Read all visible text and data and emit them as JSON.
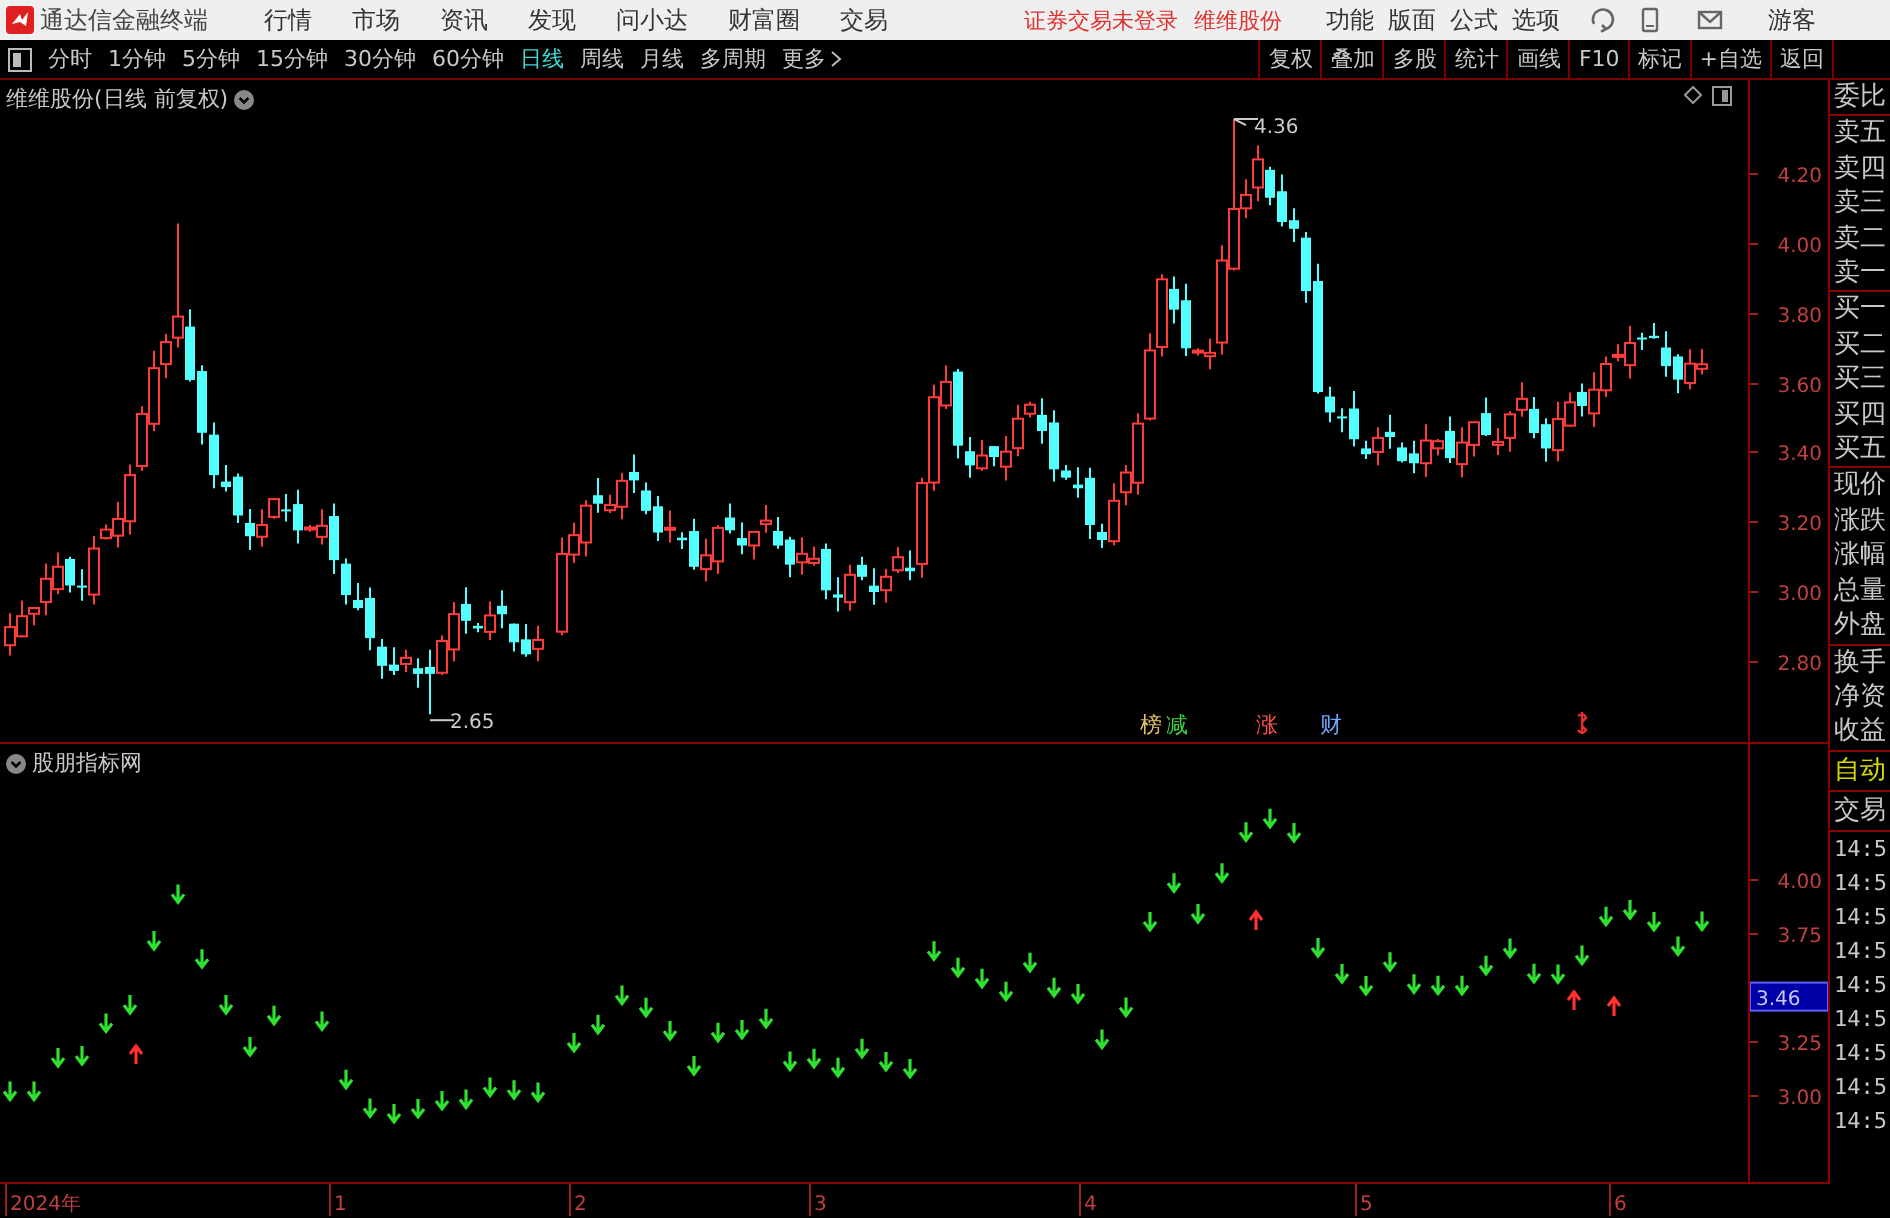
{
  "app_bar": {
    "app_name": "通达信金融终端",
    "menu": [
      "行情",
      "市场",
      "资讯",
      "发现",
      "问小达",
      "财富圈",
      "交易"
    ],
    "status_text": "证券交易未登录",
    "stock_name": "维维股份",
    "tools": [
      "功能",
      "版面",
      "公式",
      "选项"
    ],
    "user": "游客"
  },
  "period_bar": {
    "periods": [
      {
        "label": "分时",
        "selected": false
      },
      {
        "label": "1分钟",
        "selected": false
      },
      {
        "label": "5分钟",
        "selected": false
      },
      {
        "label": "15分钟",
        "selected": false
      },
      {
        "label": "30分钟",
        "selected": false
      },
      {
        "label": "60分钟",
        "selected": false
      },
      {
        "label": "日线",
        "selected": true
      },
      {
        "label": "周线",
        "selected": false
      },
      {
        "label": "月线",
        "selected": false
      },
      {
        "label": "多周期",
        "selected": false
      }
    ],
    "more": "更多",
    "actions": [
      "复权",
      "叠加",
      "多股",
      "统计",
      "画线",
      "F10",
      "标记",
      "+自选",
      "返回"
    ]
  },
  "main_chart": {
    "title": "维维股份(日线 前复权)",
    "high_label": "4.36",
    "low_label": "2.65",
    "y_ticks": [
      "4.20",
      "4.00",
      "3.80",
      "3.60",
      "3.40",
      "3.20",
      "3.00",
      "2.80"
    ],
    "markers": [
      {
        "label": "榜",
        "color": "#e0c060"
      },
      {
        "label": "减",
        "color": "#40d040"
      },
      {
        "label": "涨",
        "color": "#ff5050"
      },
      {
        "label": "财",
        "color": "#70a8ff"
      }
    ]
  },
  "indicator": {
    "title": "股朋指标网",
    "y_ticks": [
      "4.00",
      "3.75",
      "3.25",
      "3.00"
    ],
    "current_value": "3.46"
  },
  "x_axis": {
    "labels": [
      "2024年",
      "1",
      "2",
      "3",
      "4",
      "5",
      "6"
    ]
  },
  "quote_panel": {
    "labels": [
      "委比",
      "卖五",
      "卖四",
      "卖三",
      "卖二",
      "卖一",
      "买一",
      "买二",
      "买三",
      "买四",
      "买五",
      "现价",
      "涨跌",
      "涨幅",
      "总量",
      "外盘",
      "换手",
      "净资",
      "收益"
    ],
    "mode": "自动",
    "trades_title": "交易",
    "trade_times": [
      "14:5",
      "14:5",
      "14:5",
      "14:5",
      "14:5",
      "14:5",
      "14:5",
      "14:5",
      "14:5"
    ]
  }
}
